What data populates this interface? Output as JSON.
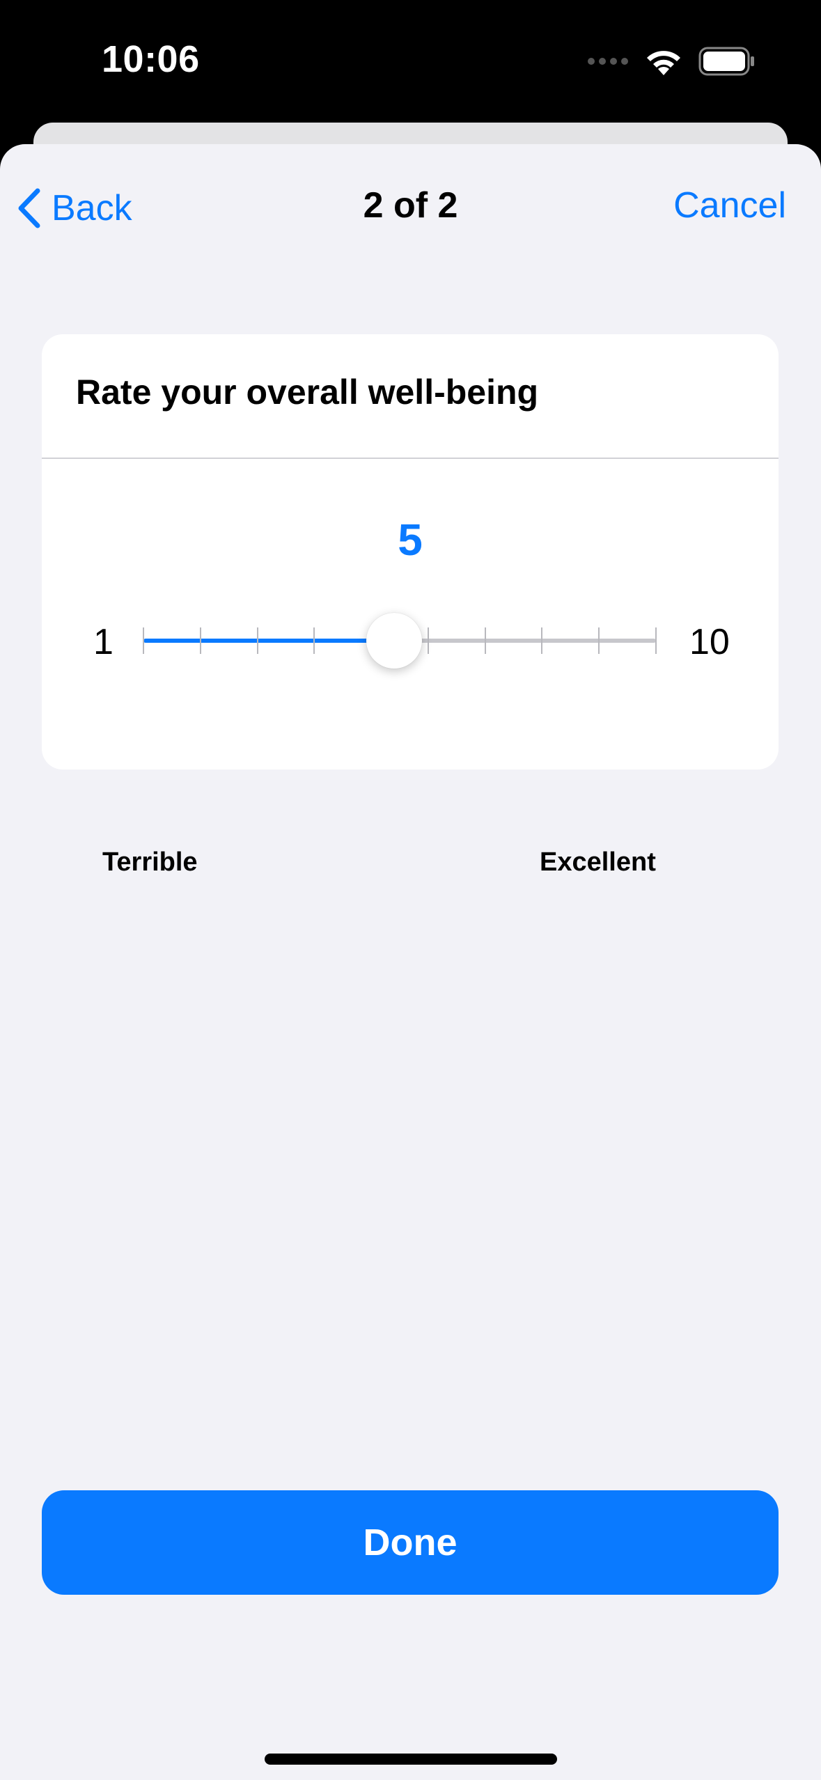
{
  "status_bar": {
    "time": "10:06",
    "icons": [
      "signal-dots-icon",
      "wifi-icon",
      "battery-icon"
    ]
  },
  "nav": {
    "back_label": "Back",
    "title": "2 of 2",
    "cancel_label": "Cancel"
  },
  "question": {
    "prompt": "Rate your overall well-being",
    "value": "5",
    "min": "1",
    "max": "10",
    "min_label": "Terrible",
    "max_label": "Excellent",
    "current": 5,
    "range": [
      1,
      10
    ]
  },
  "footer": {
    "done_label": "Done"
  },
  "colors": {
    "accent": "#0a7aff",
    "background": "#f2f2f7",
    "card": "#ffffff",
    "track": "#c7c7cc"
  }
}
